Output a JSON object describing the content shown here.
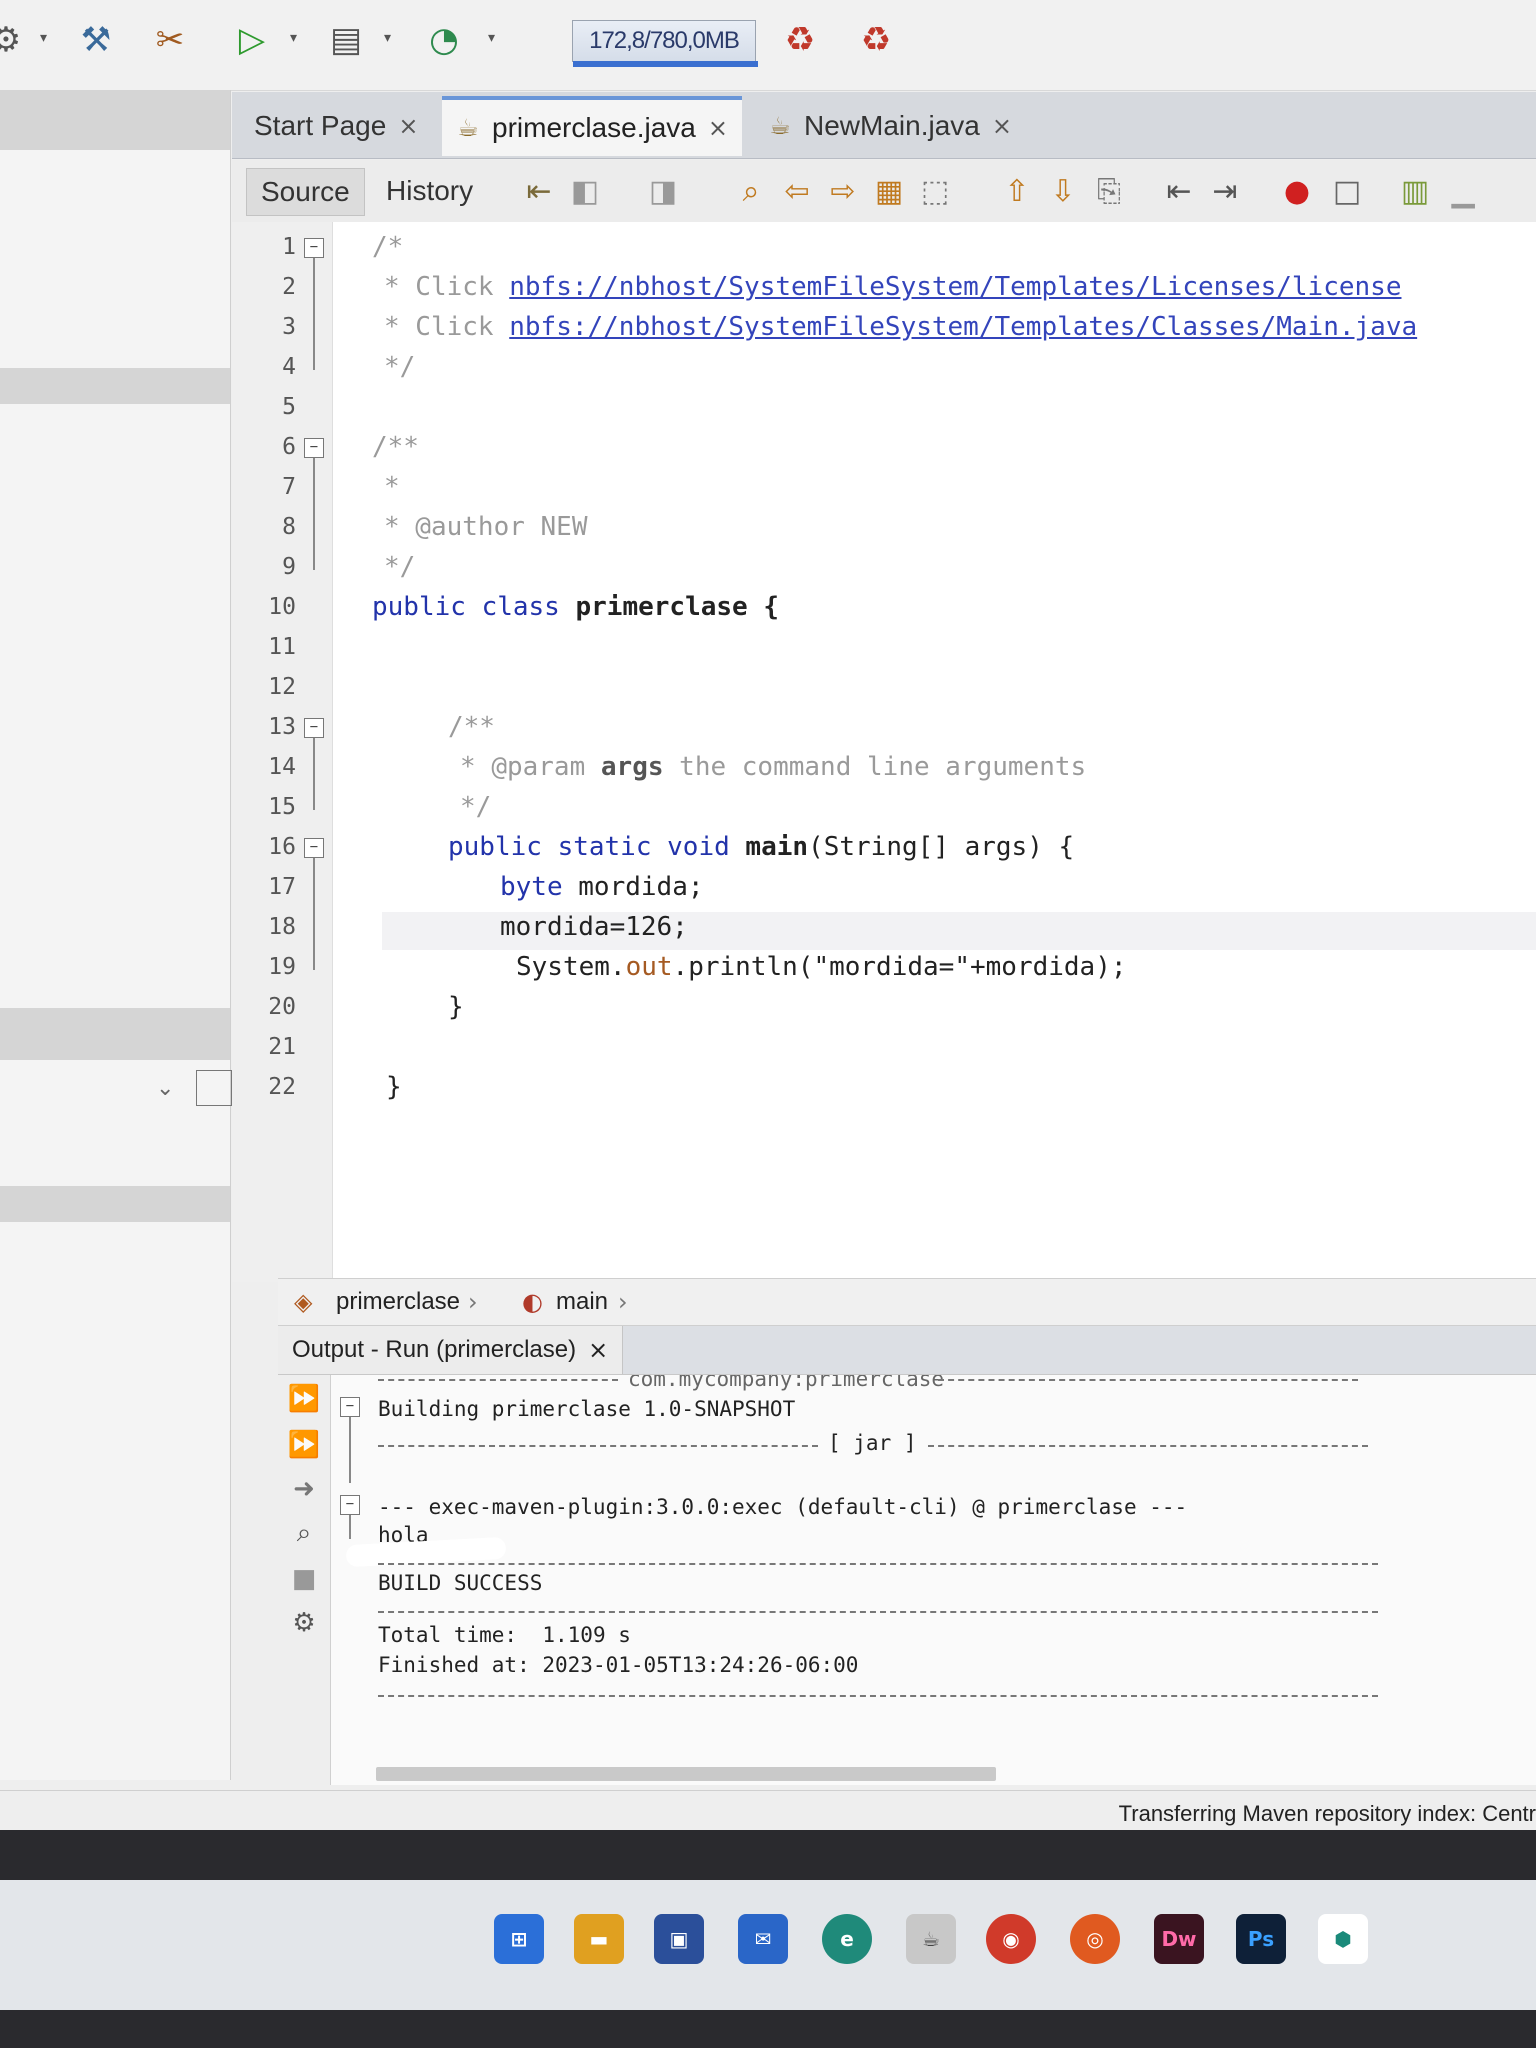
{
  "toolbar": {
    "memory": "172,8/780,0MB",
    "icons": [
      "clean-build-icon",
      "build-icon",
      "run-icon",
      "debug-icon",
      "profile-icon",
      "gc-icon",
      "gc2-icon"
    ]
  },
  "tabs": [
    {
      "label": "Start Page",
      "close": "×"
    },
    {
      "label": "primerclase.java",
      "close": "×"
    },
    {
      "label": "NewMain.java",
      "close": "×"
    }
  ],
  "editor_toolbar": {
    "source": "Source",
    "history": "History"
  },
  "code": {
    "line_numbers": [
      "1",
      "2",
      "3",
      "4",
      "5",
      "6",
      "7",
      "8",
      "9",
      "10",
      "11",
      "12",
      "13",
      "14",
      "15",
      "16",
      "17",
      "18",
      "19",
      "20",
      "21",
      "22"
    ],
    "l1": "/*",
    "l2_prefix": "* Click ",
    "l2_link": "nbfs://nbhost/SystemFileSystem/Templates/Licenses/license",
    "l3_prefix": "* Click ",
    "l3_link": "nbfs://nbhost/SystemFileSystem/Templates/Classes/Main.java",
    "l4": "*/",
    "l6": "/**",
    "l7": "*",
    "l8": "* @author NEW",
    "l9": "*/",
    "l10_kw": "public class ",
    "l10_name": "primerclase {",
    "l12": "/**",
    "l13_star": "* ",
    "l13_tag": "@param ",
    "l13_arg": "args",
    "l13_rest": " the command line arguments",
    "l14": "*/",
    "l15_kw": "public static void ",
    "l15_method": "main",
    "l15_rest": "(String[] args) {",
    "l16_kw": "byte ",
    "l16_rest": "mordida;",
    "l17": "mordida=126;",
    "l18_a": "System.",
    "l18_out": "out",
    "l18_b": ".println(",
    "l18_str": "\"mordida=\"",
    "l18_c": "+mordida);",
    "l19": "}",
    "l21": "}"
  },
  "breadcrumb": {
    "class": "primerclase",
    "method": "main"
  },
  "output": {
    "tab_label": "Output - Run (primerclase)",
    "tab_close": "×",
    "line0": "com.mycompany:primerclase",
    "line1": "Building primerclase 1.0-SNAPSHOT",
    "line2": "[ jar ]",
    "line3": "--- exec-maven-plugin:3.0.0:exec (default-cli) @ primerclase ---",
    "line4": "hola",
    "line5": "BUILD SUCCESS",
    "line6_label": "Total time:",
    "line6_value": "1.109 s",
    "line7_label": "Finished at:",
    "line7_value": "2023-01-05T13:24:26-06:00"
  },
  "status": {
    "text": "Transferring Maven repository index: Centr"
  },
  "taskbar": {
    "dreamweaver": "Dw",
    "photoshop": "Ps"
  }
}
